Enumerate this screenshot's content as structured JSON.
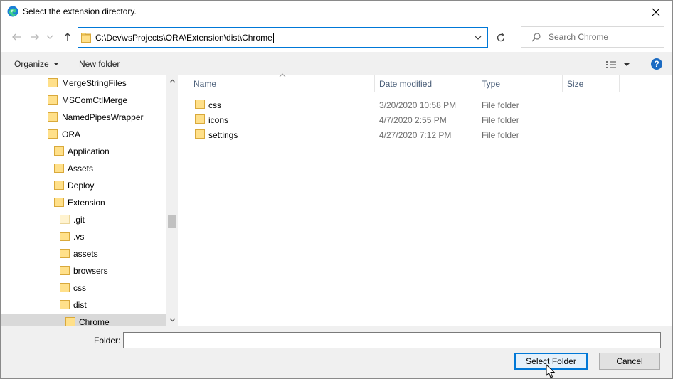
{
  "dialog": {
    "title": "Select the extension directory.",
    "accent_color": "#0078d7"
  },
  "navigation": {
    "address_path": "C:\\Dev\\vsProjects\\ORA\\Extension\\dist\\Chrome",
    "search_placeholder": "Search Chrome"
  },
  "toolbar": {
    "organize_label": "Organize",
    "new_folder_label": "New folder",
    "help_label": "?"
  },
  "tree": {
    "items": [
      {
        "label": "MergeStringFiles"
      },
      {
        "label": "MSComCtlMerge"
      },
      {
        "label": "NamedPipesWrapper"
      },
      {
        "label": "ORA"
      },
      {
        "label": "Application"
      },
      {
        "label": "Assets"
      },
      {
        "label": "Deploy"
      },
      {
        "label": "Extension"
      },
      {
        "label": ".git"
      },
      {
        "label": ".vs"
      },
      {
        "label": "assets"
      },
      {
        "label": "browsers"
      },
      {
        "label": "css"
      },
      {
        "label": "dist"
      },
      {
        "label": "Chrome"
      }
    ]
  },
  "file_list": {
    "columns": {
      "name": "Name",
      "date": "Date modified",
      "type": "Type",
      "size": "Size"
    },
    "rows": [
      {
        "name": "css",
        "date": "3/20/2020 10:58 PM",
        "type": "File folder"
      },
      {
        "name": "icons",
        "date": "4/7/2020 2:55 PM",
        "type": "File folder"
      },
      {
        "name": "settings",
        "date": "4/27/2020 7:12 PM",
        "type": "File folder"
      }
    ]
  },
  "footer": {
    "folder_label": "Folder:",
    "folder_value": "",
    "select_label": "Select Folder",
    "cancel_label": "Cancel"
  }
}
